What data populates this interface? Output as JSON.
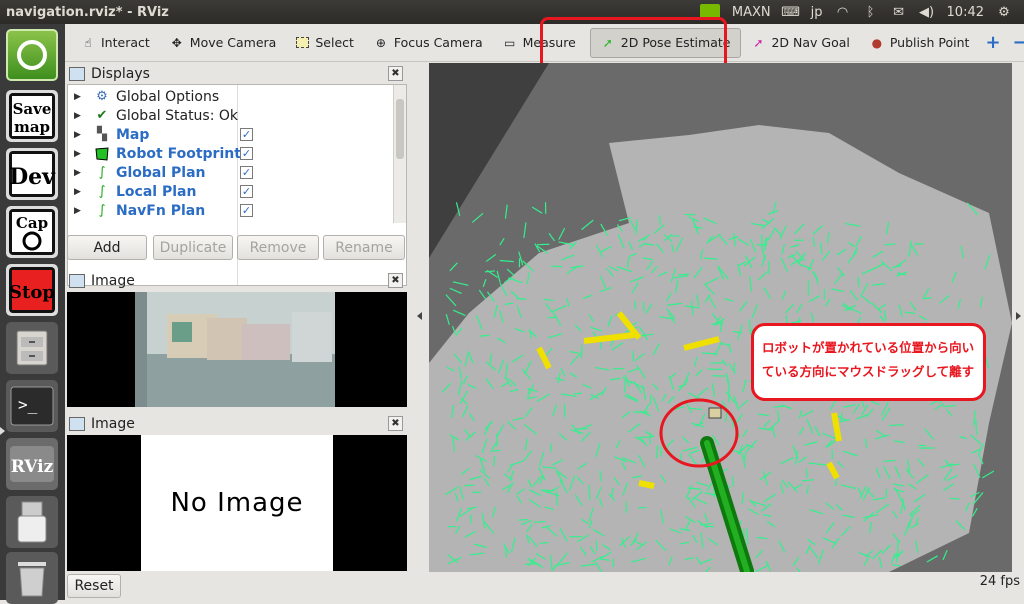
{
  "window": {
    "title": "navigation.rviz* - RViz"
  },
  "tray": {
    "gpu_label": "MAXN",
    "keyboard": "jp",
    "clock": "10:42"
  },
  "launcher": {
    "items": [
      {
        "name": "ubuntu-dash",
        "label": ""
      },
      {
        "name": "save-map",
        "label": "Save map"
      },
      {
        "name": "dev",
        "label": "Dev"
      },
      {
        "name": "cap",
        "label": "Cap"
      },
      {
        "name": "stop",
        "label": "Stop"
      },
      {
        "name": "files",
        "label": ""
      },
      {
        "name": "terminal",
        "label": ""
      },
      {
        "name": "rviz",
        "label": "RViz"
      },
      {
        "name": "usb",
        "label": ""
      },
      {
        "name": "trash",
        "label": ""
      }
    ]
  },
  "toolbar": {
    "interact": "Interact",
    "move_camera": "Move Camera",
    "select": "Select",
    "focus_camera": "Focus Camera",
    "measure": "Measure",
    "pose_estimate": "2D Pose Estimate",
    "nav_goal": "2D Nav Goal",
    "publish_point": "Publish Point",
    "plus": "+",
    "minus": "−",
    "more": "»"
  },
  "displays": {
    "title": "Displays",
    "items": [
      {
        "label": "Global Options",
        "checked": null
      },
      {
        "label": "Global Status: Ok",
        "checked": null
      },
      {
        "label": "Map",
        "checked": true
      },
      {
        "label": "Robot Footprint",
        "checked": true
      },
      {
        "label": "Global Plan",
        "checked": true
      },
      {
        "label": "Local Plan",
        "checked": true
      },
      {
        "label": "NavFn Plan",
        "checked": true
      }
    ],
    "buttons": {
      "add": "Add",
      "duplicate": "Duplicate",
      "remove": "Remove",
      "rename": "Rename"
    }
  },
  "image_panel_1": {
    "title": "Image"
  },
  "image_panel_2": {
    "title": "Image",
    "placeholder": "No Image"
  },
  "footer": {
    "reset": "Reset",
    "fps": "24 fps"
  },
  "callout": {
    "line1": "ロボットが置かれている位置から向い",
    "line2": "ている方向にマウスドラッグして離す"
  },
  "colors": {
    "highlight": "#e8161f",
    "particles": "#32f08c",
    "map_free": "#b4b4b4",
    "obstacle_yellow": "#f0e000"
  }
}
